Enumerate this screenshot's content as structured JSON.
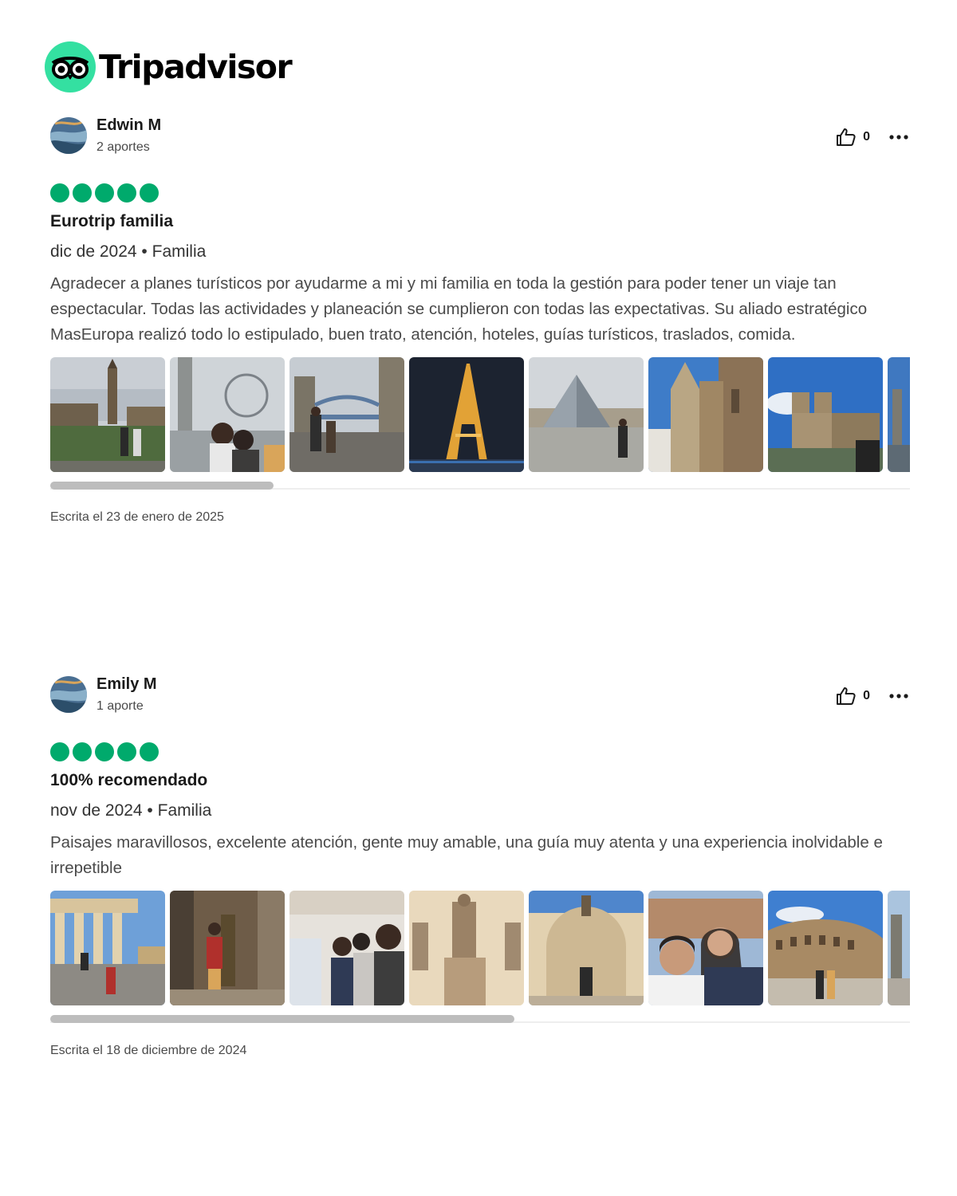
{
  "brand": {
    "name": "Tripadvisor",
    "color": "#34e0a1",
    "bubble_color": "#00aa6c"
  },
  "reviews": [
    {
      "user": {
        "name": "Edwin M",
        "contributions": "2 aportes",
        "avatar_icon": "user-avatar-icon"
      },
      "helpful_votes": "0",
      "rating": 5,
      "title": "Eurotrip familia",
      "meta": "dic de 2024 • Familia",
      "body": "Agradecer a planes turísticos por ayudarme a mi y mi familia en toda la gestión para poder tener un viaje tan espectacular. Todas las actividades y planeación se cumplieron con todas las expectativas. Su aliado estratégico MasEuropa realizó todo lo estipulado, buen trato, atención, hoteles, guías turísticos, traslados, comida.",
      "photos": [
        "big-ben-photo",
        "london-eye-photo",
        "tower-bridge-photo",
        "eiffel-tower-night-photo",
        "louvre-pyramid-photo",
        "gothic-cathedral-photo",
        "notre-dame-photo",
        "statue-photo-partial"
      ],
      "scroll_position": 0.26,
      "written": "Escrita el 23 de enero de 2025"
    },
    {
      "user": {
        "name": "Emily M",
        "contributions": "1 aporte",
        "avatar_icon": "user-avatar-icon"
      },
      "helpful_votes": "0",
      "rating": 5,
      "title": "100% recomendado",
      "meta": "nov de 2024 • Familia",
      "body": "Paisajes maravillosos, excelente atención, gente muy amable, una guía muy atenta y una experiencia inolvidable e irrepetible",
      "photos": [
        "columned-building-photo",
        "bronze-statue-photo",
        "boat-selfie-photo",
        "museum-statues-photo",
        "vatican-niche-photo",
        "couple-selfie-photo",
        "colosseum-photo",
        "statue-photo-partial"
      ],
      "scroll_position": 0.54,
      "written": "Escrita el 18 de diciembre de 2024"
    }
  ]
}
